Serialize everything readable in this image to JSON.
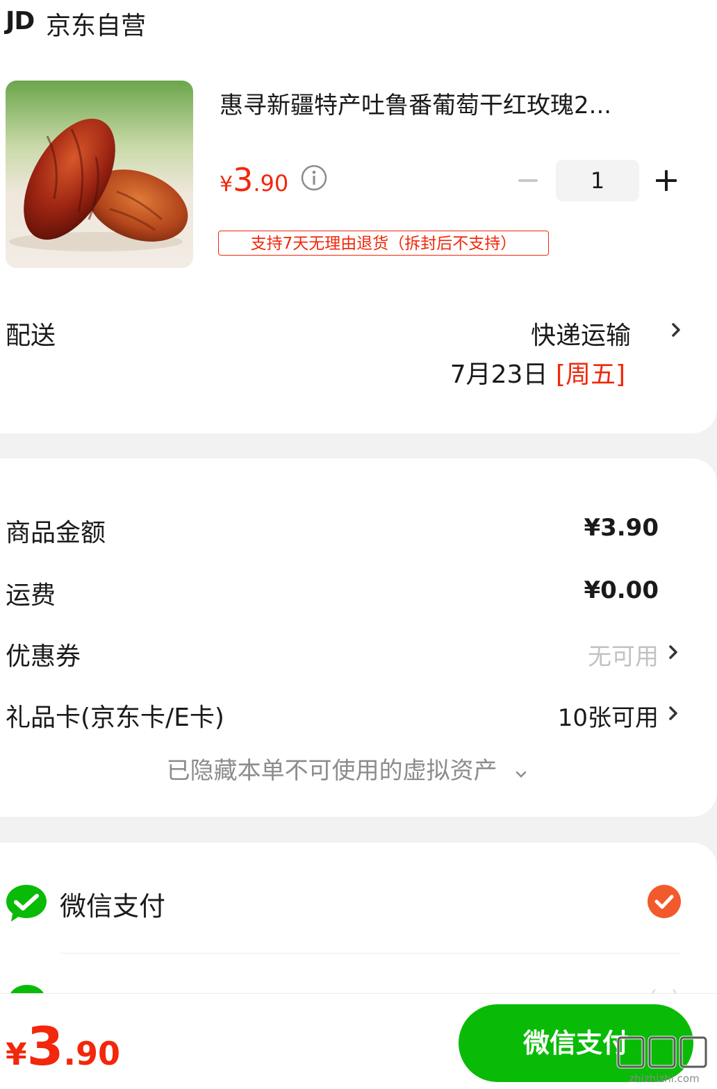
{
  "store": {
    "logo_text": "JD",
    "name": "京东自营"
  },
  "product": {
    "title": "惠寻新疆特产吐鲁番葡萄干红玫瑰2...",
    "price_symbol": "¥",
    "price_int": "3",
    "price_dec": ".90",
    "quantity": "1",
    "return_badge": "支持7天无理由退货（拆封后不支持）"
  },
  "shipping": {
    "label": "配送",
    "method": "快递运输",
    "date": "7月23日",
    "weekday": "[周五]"
  },
  "fees": [
    {
      "label": "商品金额",
      "value": "¥3.90"
    },
    {
      "label": "运费",
      "value": "¥0.00"
    },
    {
      "label": "优惠券",
      "value": "无可用"
    },
    {
      "label": "礼品卡(京东卡/E卡)",
      "value": "10张可用"
    }
  ],
  "hidden_assets_note": "已隐藏本单不可使用的虚拟资产",
  "payment": {
    "method_label": "微信支付",
    "selected": true
  },
  "footer": {
    "total_symbol": "¥",
    "total_int": "3",
    "total_dec": ".90",
    "pay_button": "微信支付",
    "watermark": "zhizhizhi.com"
  },
  "colors": {
    "accent_red": "#f2270c",
    "wechat_green": "#09bb07",
    "check_orange": "#f25a2c"
  }
}
